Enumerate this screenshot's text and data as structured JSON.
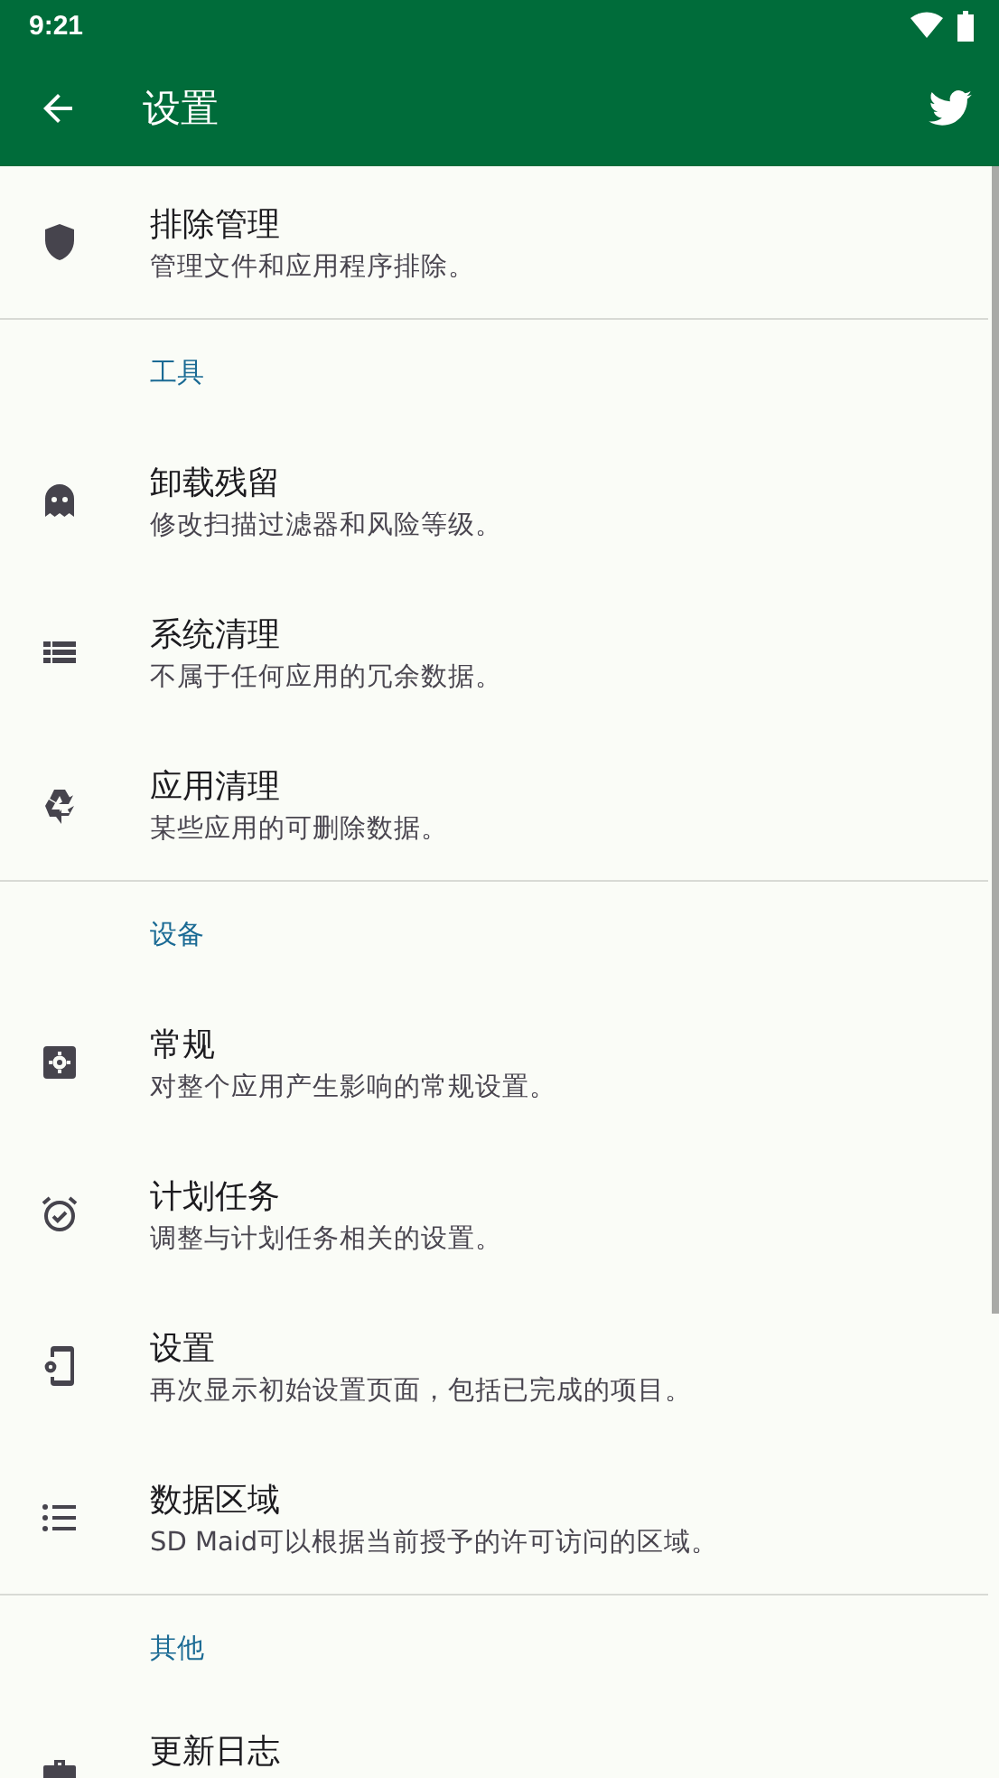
{
  "status_bar": {
    "time": "9:21"
  },
  "toolbar": {
    "title": "设置"
  },
  "sections": [
    {
      "items": [
        {
          "title": "排除管理",
          "subtitle": "管理文件和应用程序排除。"
        }
      ]
    },
    {
      "header": "工具",
      "items": [
        {
          "title": "卸载残留",
          "subtitle": "修改扫描过滤器和风险等级。"
        },
        {
          "title": "系统清理",
          "subtitle": "不属于任何应用的冗余数据。"
        },
        {
          "title": "应用清理",
          "subtitle": "某些应用的可删除数据。"
        }
      ]
    },
    {
      "header": "设备",
      "items": [
        {
          "title": "常规",
          "subtitle": "对整个应用产生影响的常规设置。"
        },
        {
          "title": "计划任务",
          "subtitle": "调整与计划任务相关的设置。"
        },
        {
          "title": "设置",
          "subtitle": "再次显示初始设置页面，包括已完成的项目。"
        },
        {
          "title": "数据区域",
          "subtitle": "SD Maid可以根据当前授予的许可访问的区域。"
        }
      ]
    },
    {
      "header": "其他",
      "items": [
        {
          "title": "更新日志"
        }
      ]
    }
  ]
}
